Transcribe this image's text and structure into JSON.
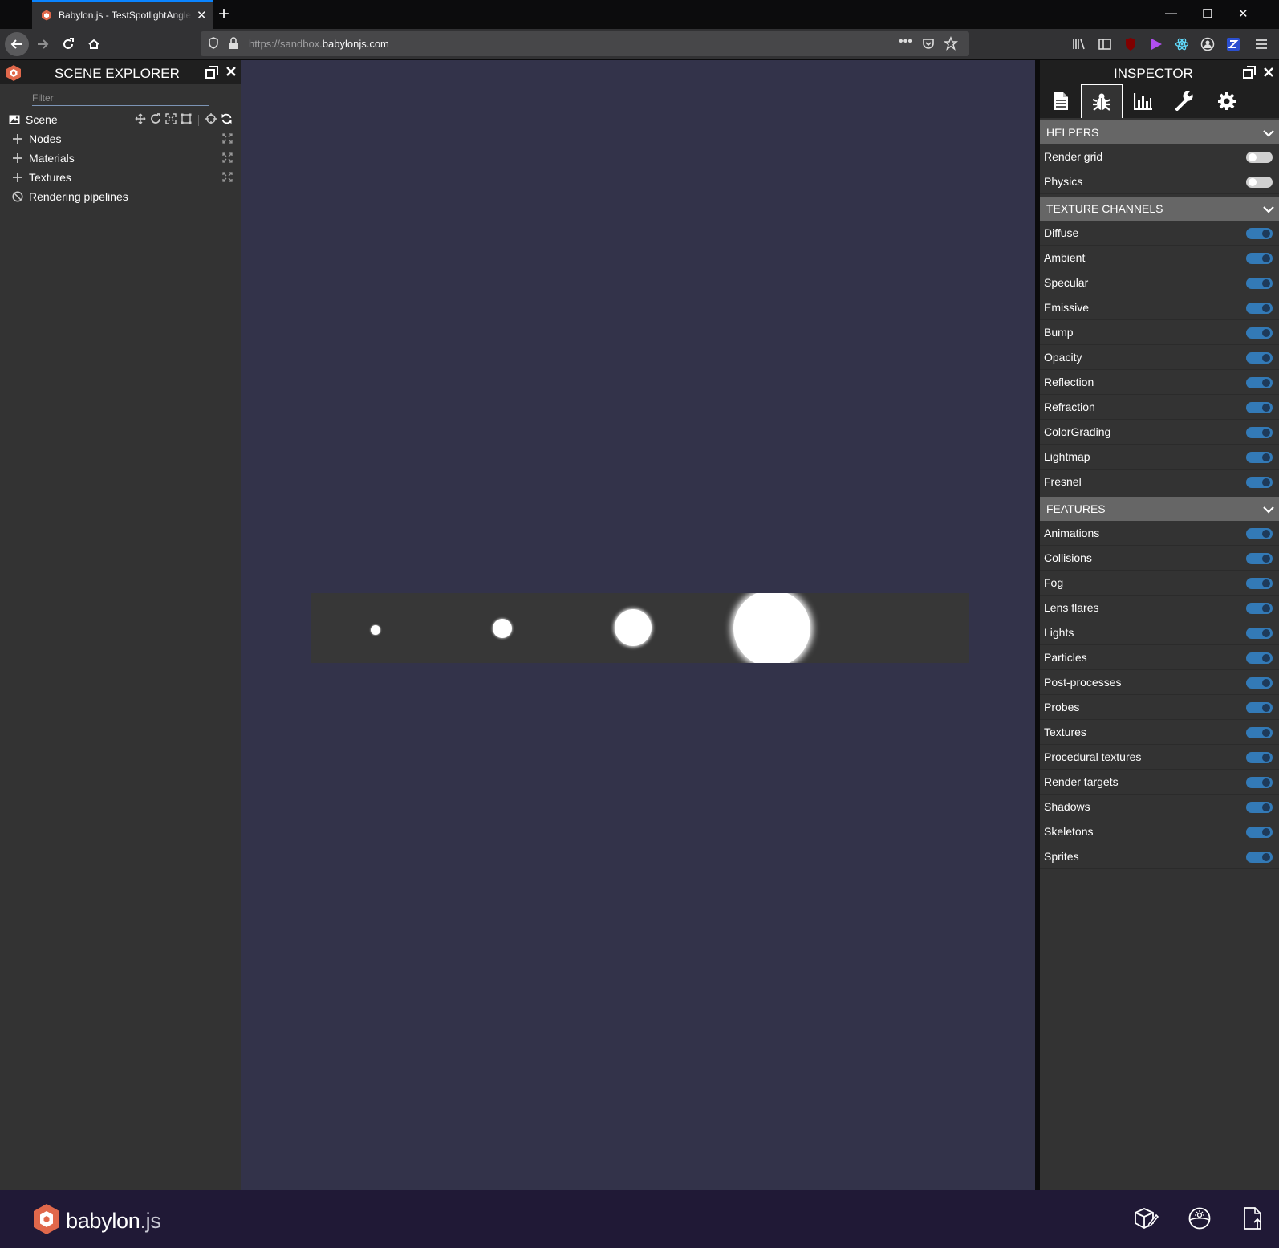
{
  "browser": {
    "tab_title": "Babylon.js - TestSpotlightAngle",
    "url_prefix": "https://sandbox.",
    "url_domain": "babylonjs.com"
  },
  "scene_explorer": {
    "title": "SCENE EXPLORER",
    "filter_placeholder": "Filter",
    "scene_label": "Scene",
    "items": [
      {
        "label": "Nodes"
      },
      {
        "label": "Materials"
      },
      {
        "label": "Textures"
      },
      {
        "label": "Rendering pipelines"
      }
    ]
  },
  "inspector": {
    "title": "INSPECTOR",
    "helpers": {
      "header": "HELPERS",
      "rows": [
        {
          "label": "Render grid",
          "on": false
        },
        {
          "label": "Physics",
          "on": false
        }
      ]
    },
    "texture_channels": {
      "header": "TEXTURE CHANNELS",
      "rows": [
        {
          "label": "Diffuse",
          "on": true
        },
        {
          "label": "Ambient",
          "on": true
        },
        {
          "label": "Specular",
          "on": true
        },
        {
          "label": "Emissive",
          "on": true
        },
        {
          "label": "Bump",
          "on": true
        },
        {
          "label": "Opacity",
          "on": true
        },
        {
          "label": "Reflection",
          "on": true
        },
        {
          "label": "Refraction",
          "on": true
        },
        {
          "label": "ColorGrading",
          "on": true
        },
        {
          "label": "Lightmap",
          "on": true
        },
        {
          "label": "Fresnel",
          "on": true
        }
      ]
    },
    "features": {
      "header": "FEATURES",
      "rows": [
        {
          "label": "Animations",
          "on": true
        },
        {
          "label": "Collisions",
          "on": true
        },
        {
          "label": "Fog",
          "on": true
        },
        {
          "label": "Lens flares",
          "on": true
        },
        {
          "label": "Lights",
          "on": true
        },
        {
          "label": "Particles",
          "on": true
        },
        {
          "label": "Post-processes",
          "on": true
        },
        {
          "label": "Probes",
          "on": true
        },
        {
          "label": "Textures",
          "on": true
        },
        {
          "label": "Procedural textures",
          "on": true
        },
        {
          "label": "Render targets",
          "on": true
        },
        {
          "label": "Shadows",
          "on": true
        },
        {
          "label": "Skeletons",
          "on": true
        },
        {
          "label": "Sprites",
          "on": true
        }
      ]
    }
  },
  "footer": {
    "brand_main": "babylon",
    "brand_ext": ".js"
  },
  "colors": {
    "accent": "#337ab7",
    "brand": "#e0684b",
    "canvas_bg": "#33334a",
    "footer_bg": "#201936"
  }
}
